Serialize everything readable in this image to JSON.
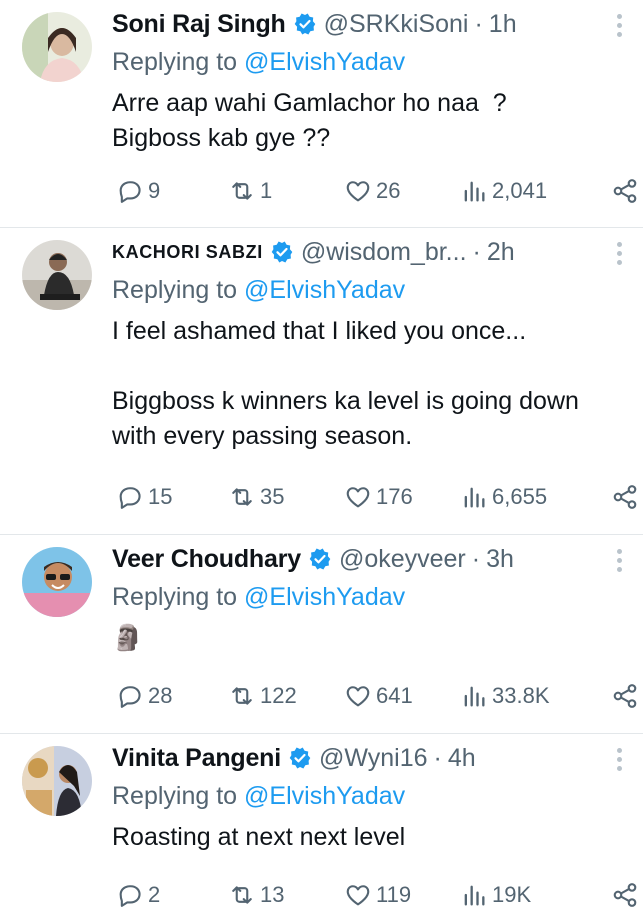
{
  "tweets": [
    {
      "name": "Soni Raj Singh",
      "handle": "@SRKkiSoni",
      "time": "1h",
      "replying_prefix": "Replying to",
      "replying_to": "@ElvishYadav",
      "text": "Arre aap wahi Gamlachor ho naa  ?\nBigboss kab gye ??",
      "replies": "9",
      "retweets": "1",
      "likes": "26",
      "views": "2,041"
    },
    {
      "name": "KACHORI SABZI",
      "handle": "@wisdom_br...",
      "time": "2h",
      "replying_prefix": "Replying to",
      "replying_to": "@ElvishYadav",
      "text": "I feel ashamed that I liked you once...\n\nBiggboss k winners ka level is going down\nwith every passing season.",
      "replies": "15",
      "retweets": "35",
      "likes": "176",
      "views": "6,655"
    },
    {
      "name": "Veer Choudhary",
      "handle": "@okeyveer",
      "time": "3h",
      "replying_prefix": "Replying to",
      "replying_to": "@ElvishYadav",
      "text": "🗿",
      "replies": "28",
      "retweets": "122",
      "likes": "641",
      "views": "33.8K"
    },
    {
      "name": "Vinita Pangeni",
      "handle": "@Wyni16",
      "time": "4h",
      "replying_prefix": "Replying to",
      "replying_to": "@ElvishYadav",
      "text": "Roasting at next next level",
      "replies": "2",
      "retweets": "13",
      "likes": "119",
      "views": "19K"
    }
  ],
  "icons": {
    "reply": "reply-icon",
    "retweet": "retweet-icon",
    "like": "heart-icon",
    "views": "views-icon",
    "share": "share-icon",
    "verified": "verified-badge-icon",
    "more": "more-icon"
  },
  "colors": {
    "verified_badge": "#1d9bf0",
    "mention": "#1d9bf0",
    "secondary_text": "#536471",
    "primary_text": "#0f1419",
    "divider": "#e3e7ea"
  }
}
